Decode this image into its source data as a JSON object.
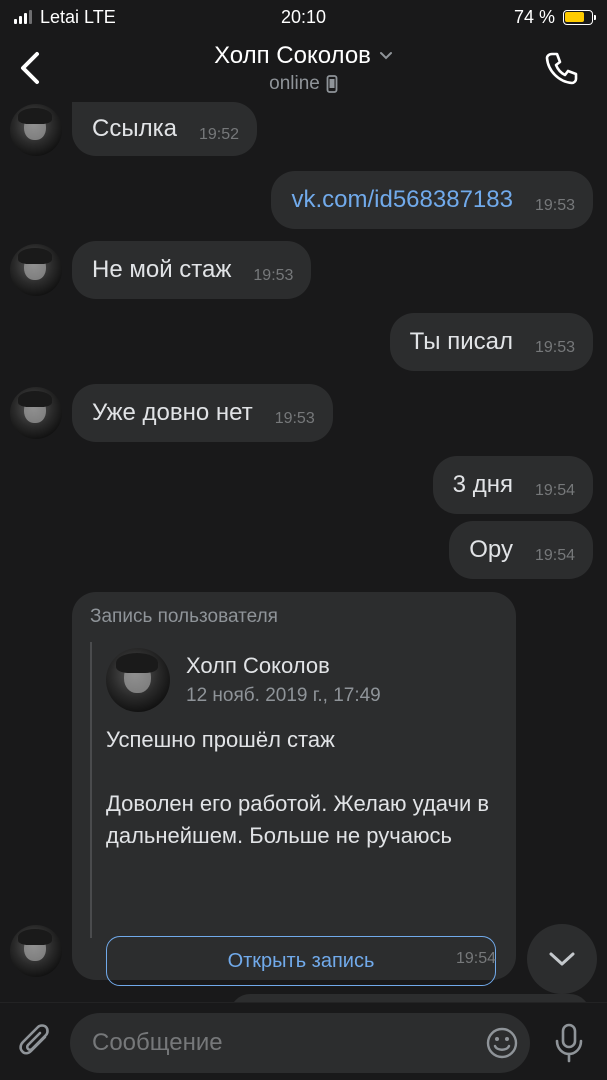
{
  "status_bar": {
    "carrier": "Letai LTE",
    "time": "20:10",
    "battery_percent": "74 %",
    "battery_level": 0.74,
    "battery_color": "#ffcc00"
  },
  "header": {
    "title": "Холп Соколов",
    "subtitle": "online",
    "icons": [
      "back-chevron-icon",
      "chevron-down-icon",
      "mobile-phone-icon",
      "phone-call-icon"
    ]
  },
  "messages": [
    {
      "direction": "in",
      "text": "Ссылка",
      "time": "19:52"
    },
    {
      "direction": "out",
      "text": "vk.com/id568387183",
      "time": "19:53",
      "is_link": true
    },
    {
      "direction": "in",
      "text": "Не мой стаж",
      "time": "19:53"
    },
    {
      "direction": "out",
      "text": "Ты писал",
      "time": "19:53"
    },
    {
      "direction": "in",
      "text": "Уже довно нет",
      "time": "19:53"
    },
    {
      "direction": "out",
      "text": "3 дня",
      "time": "19:54"
    },
    {
      "direction": "out",
      "text": "Ору",
      "time": "19:54"
    }
  ],
  "shared_post": {
    "label": "Запись пользователя",
    "author": "Холп Соколов",
    "date": "12 нояб. 2019 г., 17:49",
    "text": "Успешно прошёл стаж\n\nДоволен его работой. Желаю удачи в дальнейшем. Больше не ручаюсь",
    "button_label": "Открыть запись",
    "time": "19:54"
  },
  "composer": {
    "placeholder": "Сообщение"
  },
  "colors": {
    "background": "#19191a",
    "bubble": "#2c2d2e",
    "accent": "#71aaeb",
    "text": "#e1e3e6",
    "secondary": "#76787a"
  }
}
